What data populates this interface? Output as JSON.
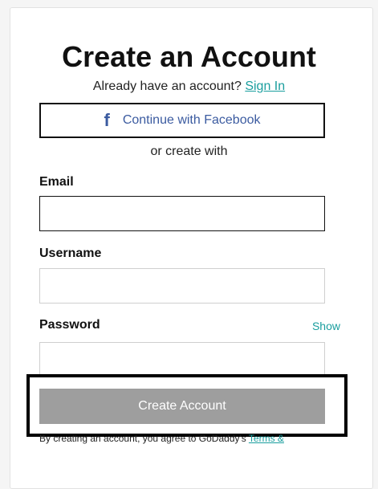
{
  "title": "Create an Account",
  "signin": {
    "prompt": "Already have an account?",
    "link": "Sign In"
  },
  "facebook": {
    "icon": "facebook-icon",
    "label": "Continue with Facebook"
  },
  "divider_text": "or create with",
  "fields": {
    "email": {
      "label": "Email",
      "value": ""
    },
    "username": {
      "label": "Username",
      "value": ""
    },
    "password": {
      "label": "Password",
      "value": "",
      "toggle": "Show"
    }
  },
  "submit": {
    "label": "Create Account"
  },
  "terms": {
    "text": "By creating an account, you agree to GoDaddy's",
    "link": "Terms &"
  },
  "colors": {
    "accent": "#1a9e9e",
    "facebook": "#3b5ba0",
    "button_disabled": "#9e9e9e"
  }
}
